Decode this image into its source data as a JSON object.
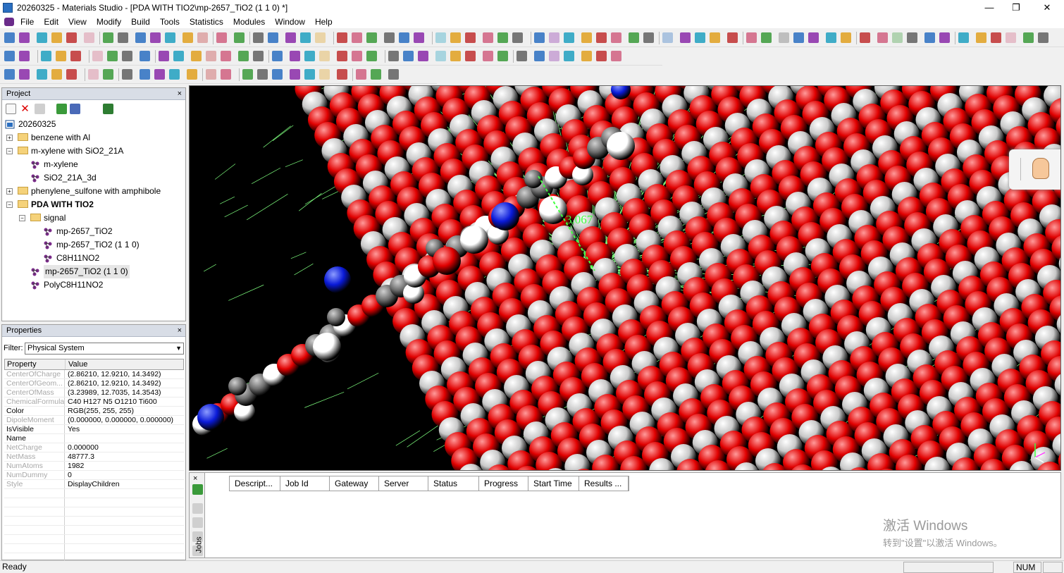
{
  "window": {
    "title": "20260325 - Materials Studio - [PDA WITH TIO2\\mp-2657_TiO2 (1 1 0) *]"
  },
  "window_controls": {
    "minimize": "—",
    "restore": "❐",
    "close": "✕"
  },
  "mdi_controls": {
    "minimize": "–",
    "restore": "❐",
    "close": "✕"
  },
  "menu": [
    "File",
    "Edit",
    "View",
    "Modify",
    "Build",
    "Tools",
    "Statistics",
    "Modules",
    "Window",
    "Help"
  ],
  "project_panel": {
    "title": "Project",
    "close": "×",
    "tree": [
      {
        "label": "20260325",
        "level": 0,
        "kind": "root",
        "expander": ""
      },
      {
        "label": "benzene with Al",
        "level": 1,
        "kind": "folder",
        "expander": "+"
      },
      {
        "label": "m-xylene with SiO2_21A",
        "level": 1,
        "kind": "folder",
        "expander": "−"
      },
      {
        "label": "m-xylene",
        "level": 2,
        "kind": "doc",
        "expander": ""
      },
      {
        "label": "SiO2_21A_3d",
        "level": 2,
        "kind": "doc",
        "expander": ""
      },
      {
        "label": "phenylene_sulfone with amphibole",
        "level": 1,
        "kind": "folder",
        "expander": "+"
      },
      {
        "label": "PDA WITH TIO2",
        "level": 1,
        "kind": "folder",
        "expander": "−",
        "bold": true
      },
      {
        "label": "signal",
        "level": 2,
        "kind": "folder",
        "expander": "−"
      },
      {
        "label": "mp-2657_TiO2",
        "level": 3,
        "kind": "doc",
        "expander": ""
      },
      {
        "label": "mp-2657_TiO2 (1 1 0)",
        "level": 3,
        "kind": "doc",
        "expander": ""
      },
      {
        "label": "C8H11NO2",
        "level": 3,
        "kind": "doc",
        "expander": ""
      },
      {
        "label": "mp-2657_TiO2 (1 1 0)",
        "level": 2,
        "kind": "doc",
        "expander": "",
        "selected": true
      },
      {
        "label": "PolyC8H11NO2",
        "level": 2,
        "kind": "doc",
        "expander": ""
      }
    ]
  },
  "properties_panel": {
    "title": "Properties",
    "close": "×",
    "filter_label": "Filter:",
    "filter_value": "Physical System",
    "columns": [
      "Property",
      "Value"
    ],
    "rows": [
      {
        "name": "CenterOfCharge",
        "value": "(2.86210, 12.9210, 14.3492)",
        "dim": true
      },
      {
        "name": "CenterOfGeom...",
        "value": "(2.86210, 12.9210, 14.3492)",
        "dim": true
      },
      {
        "name": "CenterOfMass",
        "value": "(3.23989, 12.7035, 14.3543)",
        "dim": true
      },
      {
        "name": "ChemicalFormula",
        "value": "C40 H127 N5 O1210 Ti600",
        "dim": true
      },
      {
        "name": "Color",
        "value": "RGB(255, 255, 255)",
        "dim": false
      },
      {
        "name": "DipoleMoment",
        "value": "(0.000000, 0.000000, 0.000000)",
        "dim": true
      },
      {
        "name": "IsVisible",
        "value": "Yes",
        "dim": false
      },
      {
        "name": "Name",
        "value": "",
        "dim": false
      },
      {
        "name": "NetCharge",
        "value": "0.000000",
        "dim": true
      },
      {
        "name": "NetMass",
        "value": "48777.3",
        "dim": true
      },
      {
        "name": "NumAtoms",
        "value": "1982",
        "dim": true
      },
      {
        "name": "NumDummy",
        "value": "0",
        "dim": true
      },
      {
        "name": "Style",
        "value": "DisplayChildren",
        "dim": true
      }
    ]
  },
  "viewer": {
    "distance_label": "3.067"
  },
  "jobs_panel": {
    "side_label": "Jobs",
    "close": "×",
    "columns": [
      "Descript...",
      "Job Id",
      "Gateway",
      "Server",
      "Status",
      "Progress",
      "Start Time",
      "Results ..."
    ]
  },
  "watermark": {
    "line1": "激活 Windows",
    "line2": "转到\"设置\"以激活 Windows。"
  },
  "status_bar": {
    "text": "Ready",
    "num": "NUM"
  },
  "colors": {
    "oxygen": "#e00000",
    "titanium": "#c8c8c8",
    "hydrogen": "#ffffff",
    "nitrogen": "#0a1ad8",
    "carbon": "#6e6e6e",
    "hbond": "#7fff7f",
    "distance_label": "#40ff40"
  }
}
